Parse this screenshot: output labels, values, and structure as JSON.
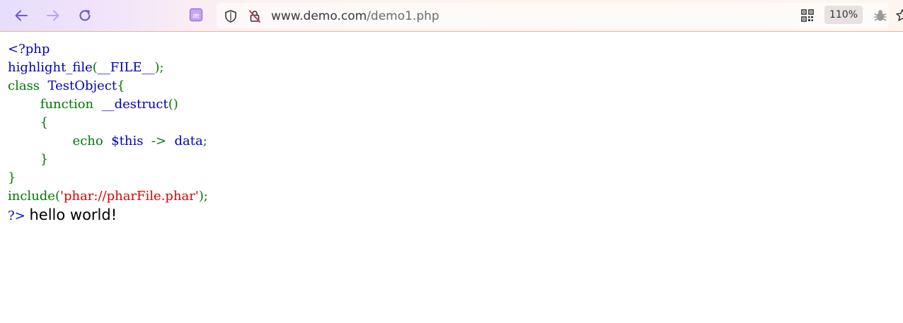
{
  "browser": {
    "url_host": "www.demo.com",
    "url_path": "/demo1.php",
    "zoom": "110%",
    "icons": {
      "back": "back-arrow-icon",
      "forward": "forward-arrow-icon",
      "reload": "reload-icon",
      "reader": "reader-mode-icon",
      "shield": "tracking-shield-icon",
      "insecure": "insecure-connection-icon",
      "qr": "qr-code-icon",
      "extension": "bug-extension-icon",
      "bookmark": "bookmark-star-icon"
    },
    "colors": {
      "nav_active": "#6b5cd6",
      "nav_disabled": "#b3a8ee",
      "reader": "#a070e0",
      "insecure": "#d0304a"
    }
  },
  "code": {
    "colors": {
      "default": "#0000BB",
      "keyword": "#007700",
      "string": "#DD0000"
    },
    "line1": "<?php",
    "line2_fn": "highlight_file",
    "line2_open": "(",
    "line2_arg": "__FILE__",
    "line2_close": ");",
    "line3_kw": "class",
    "line3_name": "TestObject",
    "line3_brace": "{",
    "line4_kw": "function",
    "line4_name": "__destruct",
    "line4_paren": "()",
    "line5_brace": "{",
    "line6_kw": "echo",
    "line6_var": "$this",
    "line6_arrow": "->",
    "line6_prop": "data",
    "line6_semi": ";",
    "line7_brace": "}",
    "line8_brace": "}",
    "line9_fn": "include",
    "line9_open": "(",
    "line9_str": "'phar://pharFile.phar'",
    "line9_close": ");",
    "line10_close": "?>"
  },
  "output": "hello world!"
}
